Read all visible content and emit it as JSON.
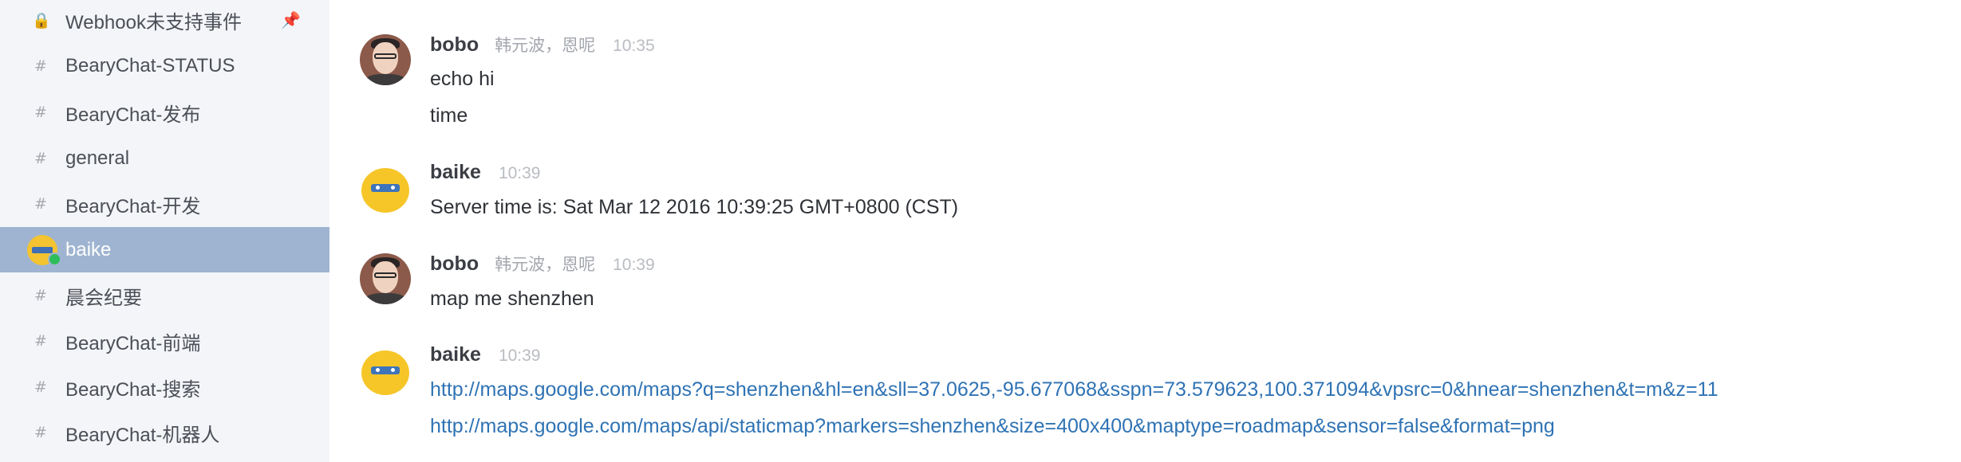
{
  "sidebar": {
    "items": [
      {
        "icon": "🔒",
        "label": "Webhook未支持事件",
        "pin": "📌"
      },
      {
        "icon": "#",
        "label": "BearyChat-STATUS"
      },
      {
        "icon": "#",
        "label": "BearyChat-发布"
      },
      {
        "icon": "#",
        "label": "general"
      },
      {
        "icon": "#",
        "label": "BearyChat-开发"
      },
      {
        "label": "baike"
      },
      {
        "icon": "#",
        "label": "晨会纪要"
      },
      {
        "icon": "#",
        "label": "BearyChat-前端"
      },
      {
        "icon": "#",
        "label": "BearyChat-搜索"
      },
      {
        "icon": "#",
        "label": "BearyChat-机器人"
      }
    ]
  },
  "messages": [
    {
      "sender": "bobo",
      "meta": "韩元波，恩呢",
      "time": "10:35",
      "lines": [
        "echo hi",
        "time"
      ]
    },
    {
      "sender": "baike",
      "time": "10:39",
      "lines": [
        "Server time is: Sat Mar 12 2016 10:39:25 GMT+0800 (CST)"
      ]
    },
    {
      "sender": "bobo",
      "meta": "韩元波，恩呢",
      "time": "10:39",
      "lines": [
        "map me shenzhen"
      ]
    },
    {
      "sender": "baike",
      "time": "10:39",
      "links": [
        "http://maps.google.com/maps?q=shenzhen&hl=en&sll=37.0625,-95.677068&sspn=73.579623,100.371094&vpsrc=0&hnear=shenzhen&t=m&z=11",
        "http://maps.google.com/maps/api/staticmap?markers=shenzhen&size=400x400&maptype=roadmap&sensor=false&format=png"
      ]
    }
  ],
  "colors": {
    "sidebar_bg": "#f4f5f8",
    "active_item_bg": "#9fb4d0",
    "link": "#2f73b4",
    "status_online": "#2ebd5b"
  }
}
